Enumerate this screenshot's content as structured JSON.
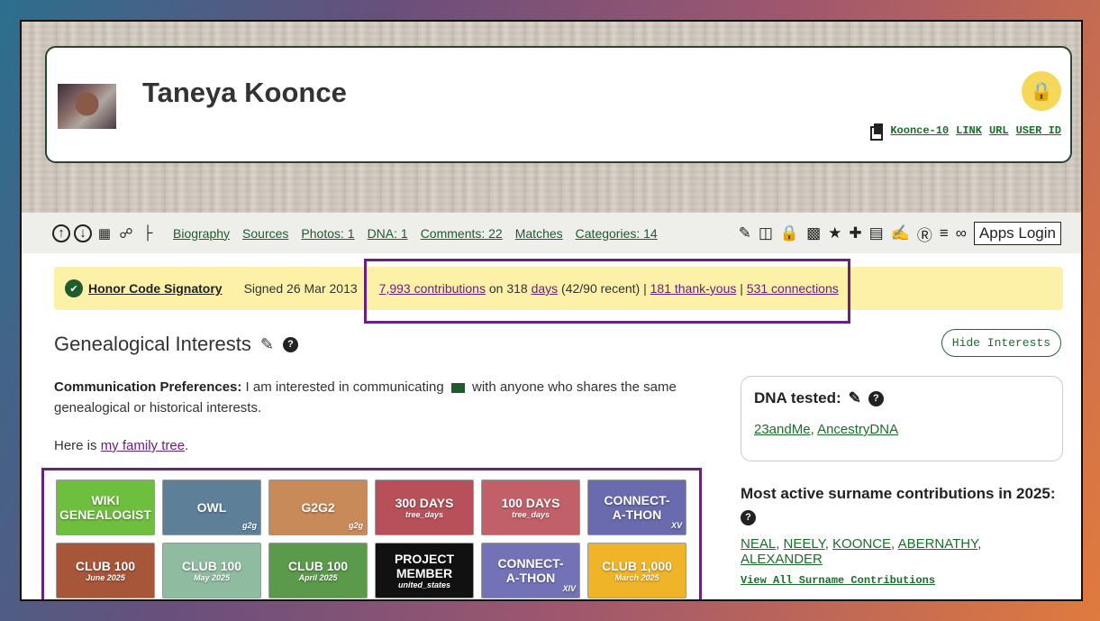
{
  "profile": {
    "name": "Taneya Koonce",
    "wiki_id": "Koonce-10",
    "links": [
      "LINK",
      "URL",
      "USER ID"
    ]
  },
  "nav": {
    "links": [
      "Biography",
      "Sources",
      "Photos: 1",
      "DNA: 1",
      "Comments: 22",
      "Matches",
      "Categories: 14"
    ],
    "apps_login": "Apps Login"
  },
  "honor": {
    "signatory": "Honor Code Signatory",
    "signed": "Signed 26 Mar 2013",
    "contributions": "7,993 contributions",
    "on": " on 318 ",
    "days": "days",
    "recent": " (42/90 recent) | ",
    "thanks": "181 thank-yous",
    "sep": " | ",
    "connections": "531 connections"
  },
  "interests": {
    "title": "Genealogical Interests",
    "hide_button": "Hide Interests",
    "comm_label": "Communication Preferences:",
    "comm_text_1": " I am interested in communicating ",
    "comm_text_2": " with anyone who shares the same genealogical or historical interests.",
    "family_prefix": "Here is ",
    "family_link": "my family tree",
    "family_suffix": "."
  },
  "badges": [
    {
      "line1": "WIKI",
      "line2": "GENEALOGIST",
      "sub": "",
      "corner": "",
      "color": "#6fbf3f"
    },
    {
      "line1": "OWL",
      "line2": "",
      "sub": "",
      "corner": "g2g",
      "color": "#5e7f98"
    },
    {
      "line1": "G2G2",
      "line2": "",
      "sub": "",
      "corner": "g2g",
      "color": "#c98a5a"
    },
    {
      "line1": "300 DAYS",
      "line2": "",
      "sub": "tree_days",
      "corner": "",
      "color": "#b8505a"
    },
    {
      "line1": "100 DAYS",
      "line2": "",
      "sub": "tree_days",
      "corner": "",
      "color": "#c2606a"
    },
    {
      "line1": "CONNECT-",
      "line2": "A-THON",
      "sub": "",
      "corner": "XV",
      "color": "#6a6aae"
    },
    {
      "line1": "CLUB 100",
      "line2": "",
      "sub": "June 2025",
      "corner": "",
      "color": "#a8563a"
    },
    {
      "line1": "CLUB 100",
      "line2": "",
      "sub": "May 2025",
      "corner": "",
      "color": "#8fbca0"
    },
    {
      "line1": "CLUB 100",
      "line2": "",
      "sub": "April 2025",
      "corner": "",
      "color": "#5a9a4a"
    },
    {
      "line1": "PROJECT",
      "line2": "MEMBER",
      "sub": "united_states",
      "corner": "",
      "color": "#111111"
    },
    {
      "line1": "CONNECT-",
      "line2": "A-THON",
      "sub": "",
      "corner": "XIV",
      "color": "#7472b6"
    },
    {
      "line1": "CLUB 1,000",
      "line2": "",
      "sub": "March 2025",
      "corner": "",
      "color": "#f0b429"
    }
  ],
  "dna": {
    "title": "DNA tested:",
    "tests": [
      "23andMe",
      "AncestryDNA"
    ]
  },
  "surnames": {
    "title": "Most active surname contributions in 2025:",
    "names": [
      "NEAL",
      "NEELY",
      "KOONCE",
      "ABERNATHY",
      "ALEXANDER"
    ],
    "view_all": "View All Surname Contributions"
  }
}
